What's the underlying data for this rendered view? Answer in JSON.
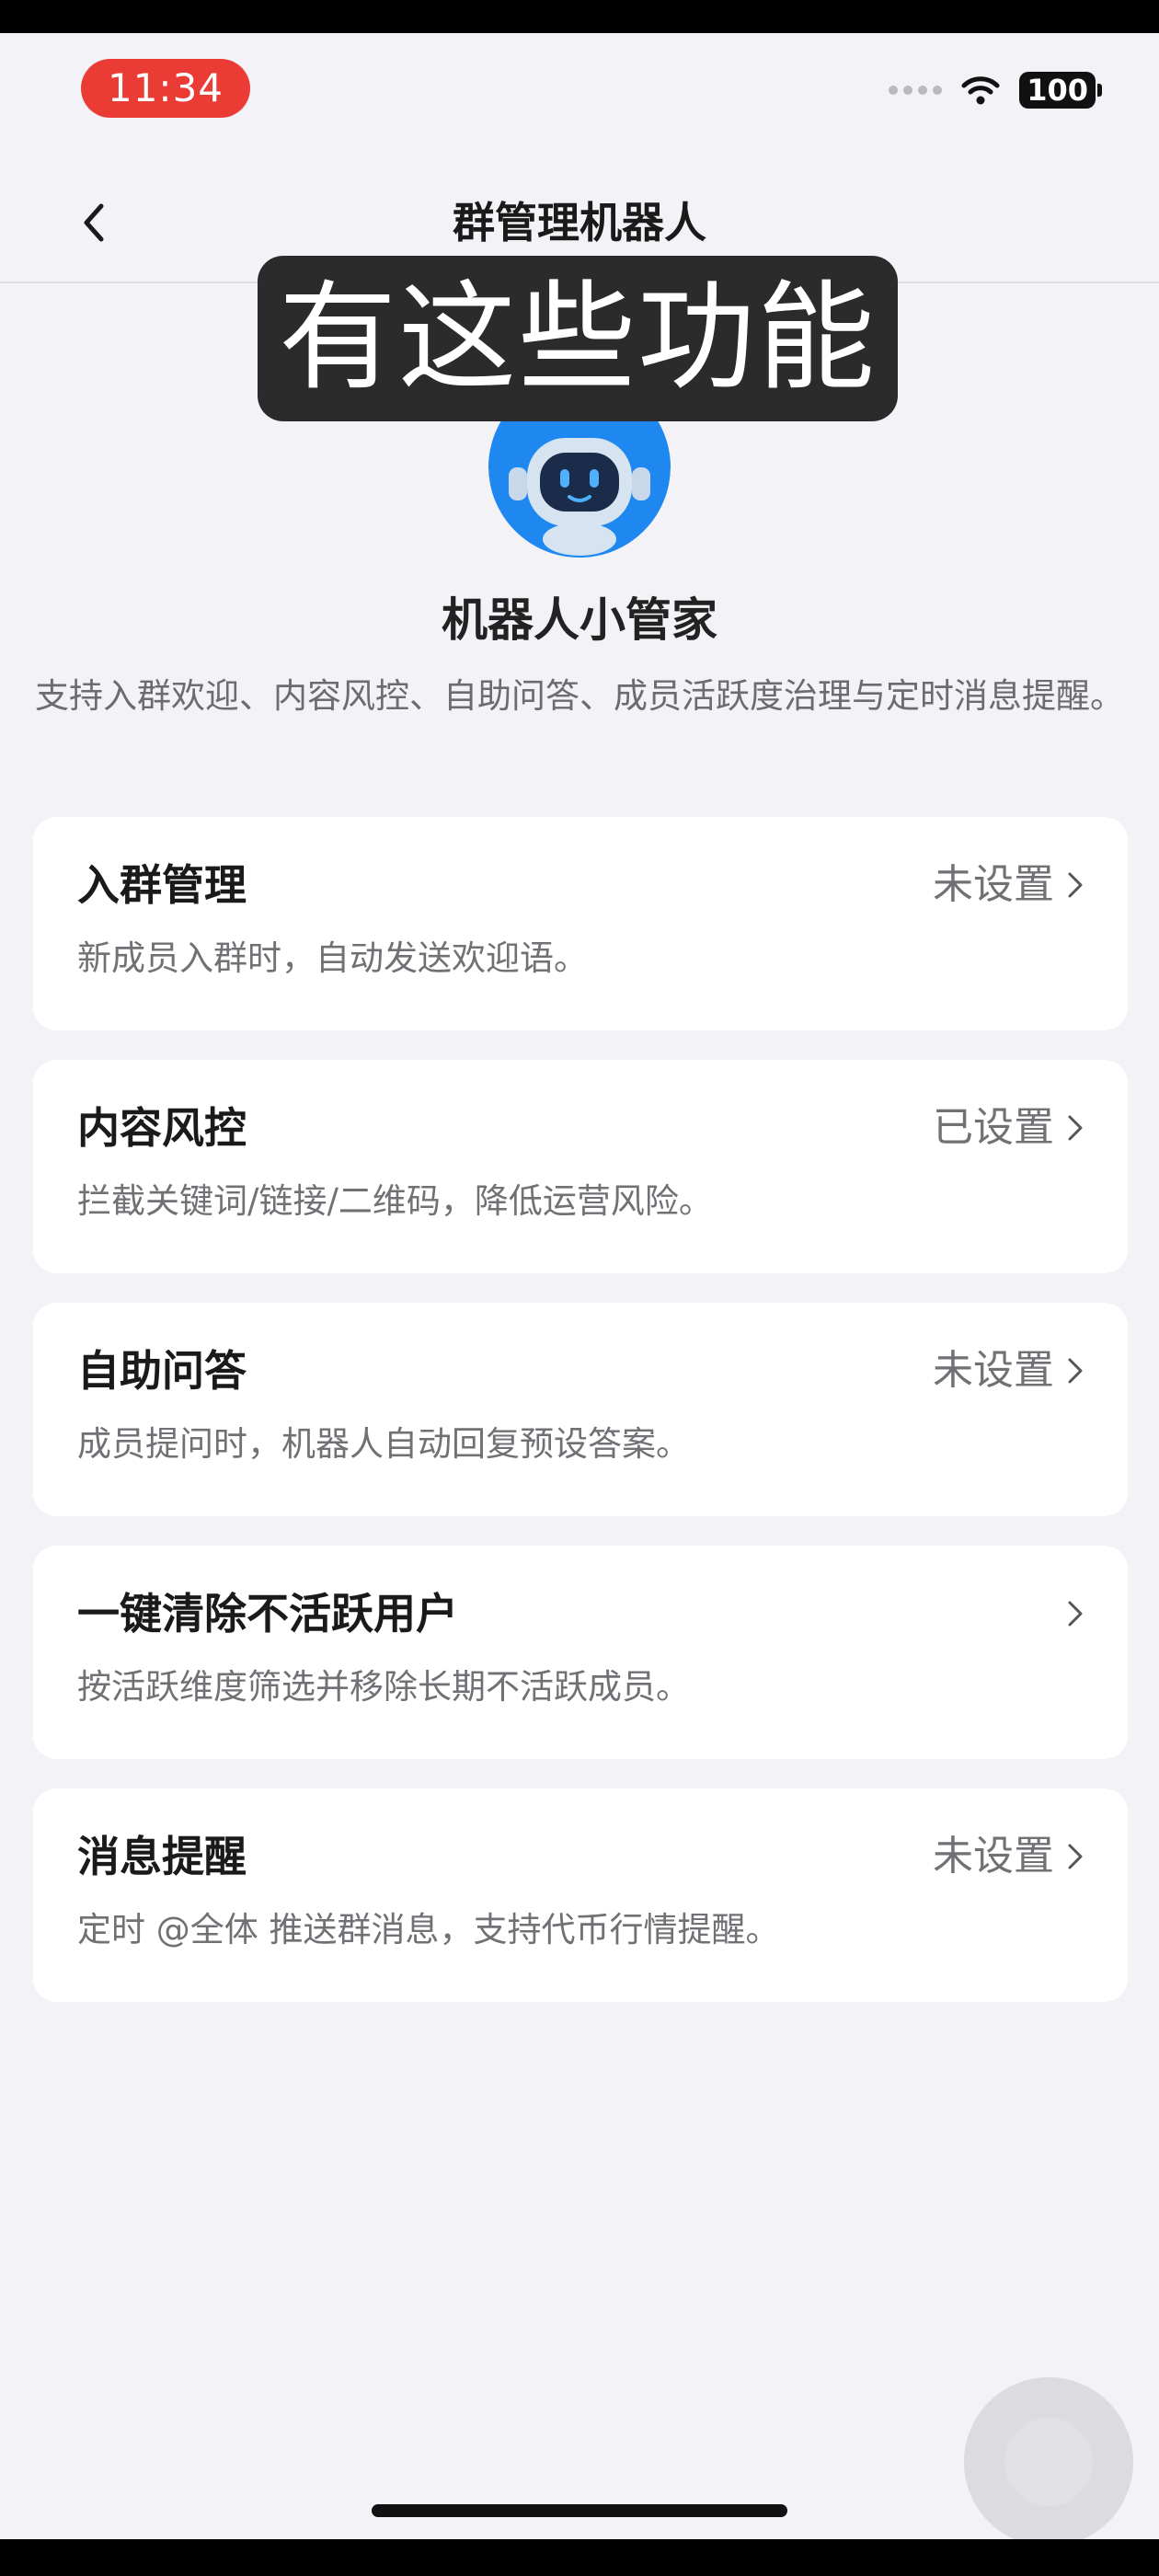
{
  "status_bar": {
    "time": "11:34",
    "battery": "100",
    "time_pill_color": "#EA3B35"
  },
  "nav": {
    "title": "群管理机器人",
    "back_icon": "chevron-left-icon"
  },
  "overlay_caption": "有这些功能",
  "bot": {
    "name": "机器人小管家",
    "description": "支持入群欢迎、内容风控、自助问答、成员活跃度治理与定时消息提醒。",
    "avatar_color": "#1E88F0"
  },
  "features": [
    {
      "title": "入群管理",
      "description": "新成员入群时，自动发送欢迎语。",
      "status": "未设置"
    },
    {
      "title": "内容风控",
      "description": "拦截关键词/链接/二维码，降低运营风险。",
      "status": "已设置"
    },
    {
      "title": "自助问答",
      "description": "成员提问时，机器人自动回复预设答案。",
      "status": "未设置"
    },
    {
      "title": "一键清除不活跃用户",
      "description": "按活跃维度筛选并移除长期不活跃成员。",
      "status": ""
    },
    {
      "title": "消息提醒",
      "description": "定时 @全体 推送群消息，支持代币行情提醒。",
      "status": "未设置"
    }
  ]
}
